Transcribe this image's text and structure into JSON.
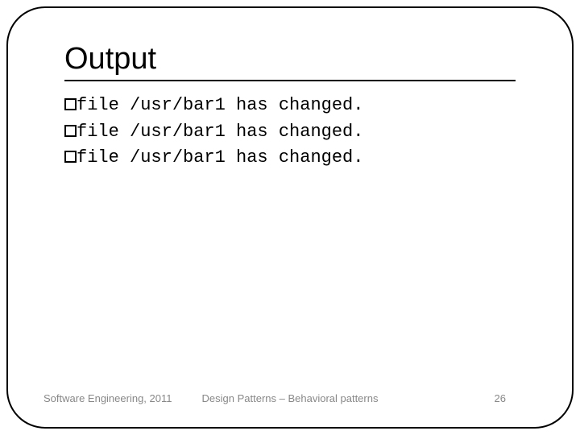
{
  "slide": {
    "title": "Output",
    "lines": [
      "file /usr/bar1 has changed.",
      "file /usr/bar1 has changed.",
      "file /usr/bar1 has changed."
    ]
  },
  "footer": {
    "left": "Software Engineering, 2011",
    "center": "Design Patterns – Behavioral patterns",
    "page": "26"
  }
}
